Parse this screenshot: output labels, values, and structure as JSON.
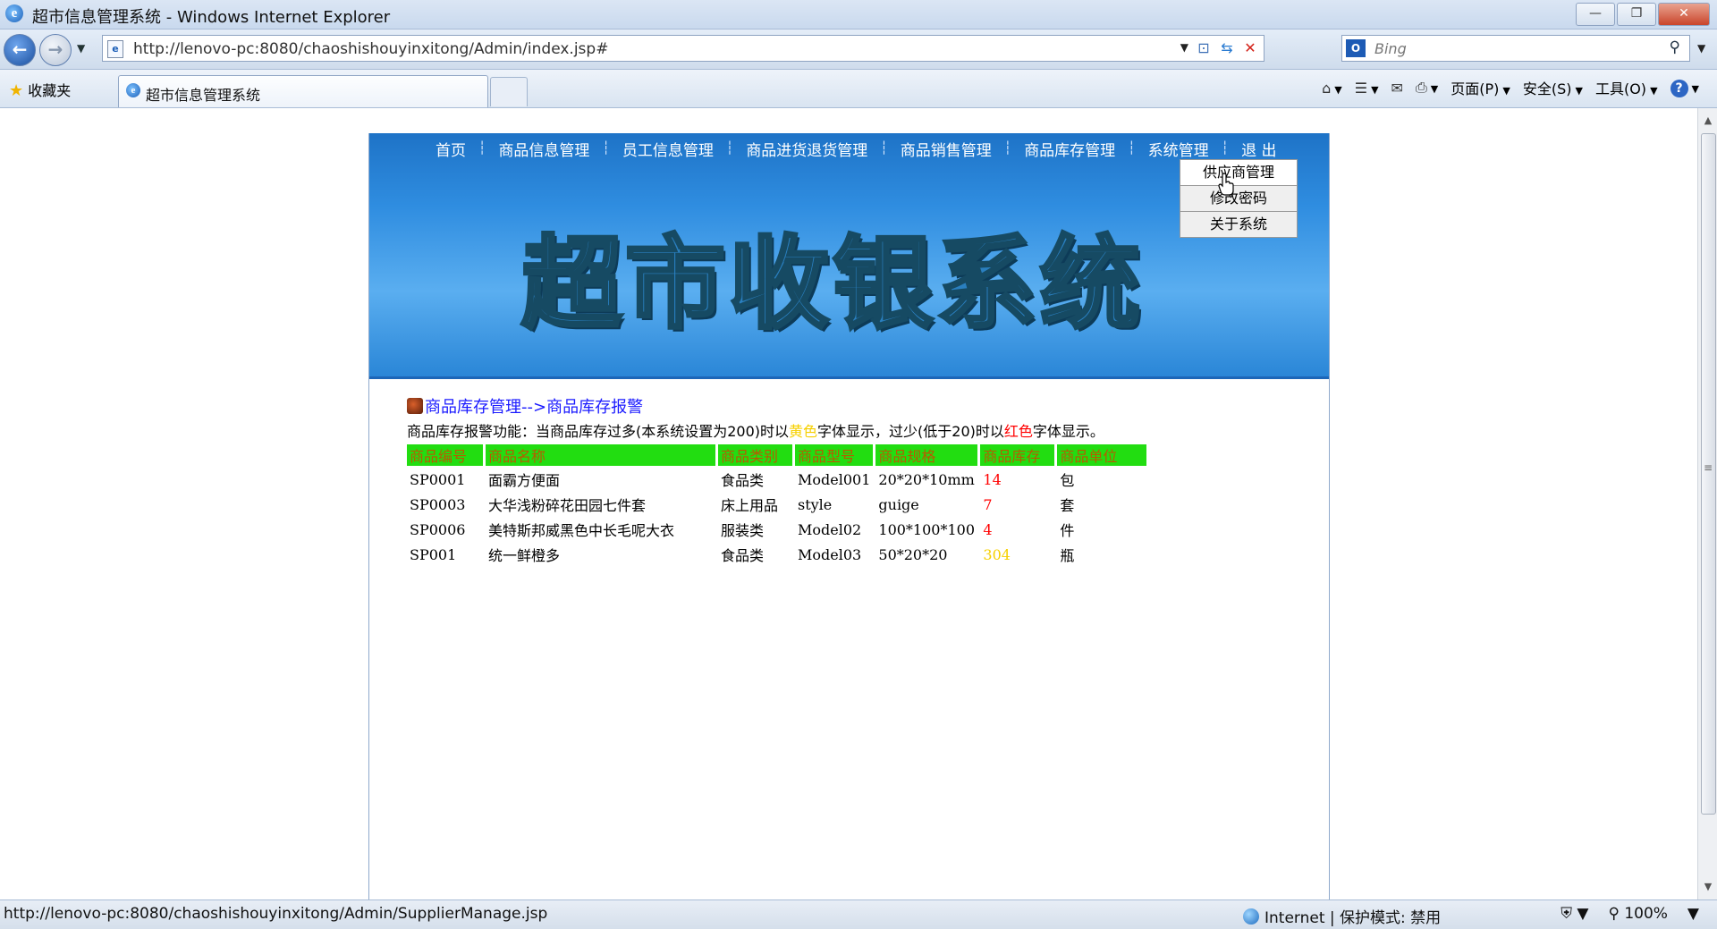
{
  "window": {
    "title": "超市信息管理系统 - Windows Internet Explorer",
    "controls": [
      "—",
      "❐",
      "✕"
    ]
  },
  "address": {
    "url": "http://lenovo-pc:8080/chaoshishouyinxitong/Admin/index.jsp#",
    "search_placeholder": "Bing"
  },
  "favorites": {
    "label": "收藏夹"
  },
  "tab": {
    "title": "超市信息管理系统"
  },
  "commands": {
    "page": "页面(P)",
    "safety": "安全(S)",
    "tools": "工具(O)"
  },
  "site": {
    "nav": [
      "首页",
      "商品信息管理",
      "员工信息管理",
      "商品进货退货管理",
      "商品销售管理",
      "商品库存管理",
      "系统管理",
      "退 出"
    ],
    "submenu": [
      "供应商管理",
      "修改密码",
      "关于系统"
    ],
    "logo": "超市收银系统",
    "breadcrumb": "商品库存管理-->商品库存报警",
    "notice": {
      "part1": "商品库存报警功能：当商品库存过多(本系统设置为200)时以",
      "yellow": "黄色",
      "part2": "字体显示，过少(低于20)时以",
      "red": "红色",
      "part3": "字体显示。"
    },
    "table": {
      "headers": [
        "商品编号",
        "商品名称",
        "商品类别",
        "商品型号",
        "商品规格",
        "商品库存",
        "商品单位"
      ],
      "rows": [
        [
          "SP0001",
          "面霸方便面",
          "食品类",
          "Model001",
          "20*20*10mm",
          "14",
          "包"
        ],
        [
          "SP0003",
          "大华浅粉碎花田园七件套",
          "床上用品",
          "style",
          "guige",
          "7",
          "套"
        ],
        [
          "SP0006",
          "美特斯邦威黑色中长毛呢大衣",
          "服装类",
          "Model02",
          "100*100*100",
          "4",
          "件"
        ],
        [
          "SP001",
          "统一鲜橙多",
          "食品类",
          "Model03",
          "50*20*20",
          "304",
          "瓶"
        ]
      ]
    }
  },
  "status": {
    "url": "http://lenovo-pc:8080/chaoshishouyinxitong/Admin/SupplierManage.jsp",
    "zone": "Internet | 保护模式: 禁用",
    "zoom": "100%"
  },
  "colors": {
    "banner": "#2f8de0",
    "header_bg": "#22dd11",
    "header_text": "#b85a00",
    "low": "#ff0000",
    "high": "#f6d000"
  }
}
